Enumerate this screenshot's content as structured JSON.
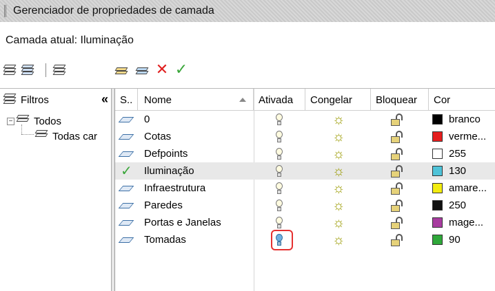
{
  "window": {
    "title": "Gerenciador de propriedades de camada"
  },
  "current_layer_label": "Camada atual: Iluminação",
  "toolbar": {
    "left_icons": [
      "new-property-filter-icon",
      "new-group-filter-icon",
      "layer-states-manager-icon"
    ],
    "right_icons": [
      "new-layer-icon",
      "new-layer-vp-frozen-icon",
      "delete-layer-icon",
      "set-current-icon"
    ],
    "delete_color": "#e02020",
    "check_color": "#3aa63a"
  },
  "filters": {
    "header": "Filtros",
    "collapse_glyph": "«",
    "tree": [
      {
        "label": "Todos",
        "expander": "−"
      },
      {
        "label": "Todas car"
      }
    ]
  },
  "columns": [
    "S..",
    "Nome",
    "Ativada",
    "Congelar",
    "Bloquear",
    "Cor"
  ],
  "layers": [
    {
      "status": "layer",
      "name": "0",
      "on": true,
      "color_name": "branco",
      "color_hex": "#000000"
    },
    {
      "status": "layer",
      "name": "Cotas",
      "on": true,
      "color_name": "verme...",
      "color_hex": "#e41e1e"
    },
    {
      "status": "layer",
      "name": "Defpoints",
      "on": true,
      "color_name": "255",
      "color_hex": "#ffffff"
    },
    {
      "status": "current",
      "name": "Iluminação",
      "on": true,
      "color_name": "130",
      "color_hex": "#4fc3d8"
    },
    {
      "status": "layer",
      "name": "Infraestrutura",
      "on": true,
      "color_name": "amare...",
      "color_hex": "#f2ec10"
    },
    {
      "status": "layer",
      "name": "Paredes",
      "on": true,
      "color_name": "250",
      "color_hex": "#111111"
    },
    {
      "status": "layer",
      "name": "Portas e Janelas",
      "on": true,
      "color_name": "mage...",
      "color_hex": "#a83ca0"
    },
    {
      "status": "layer",
      "name": "Tomadas",
      "on": false,
      "color_name": "90",
      "color_hex": "#2fa83a"
    }
  ],
  "highlight_color": "#e53030"
}
